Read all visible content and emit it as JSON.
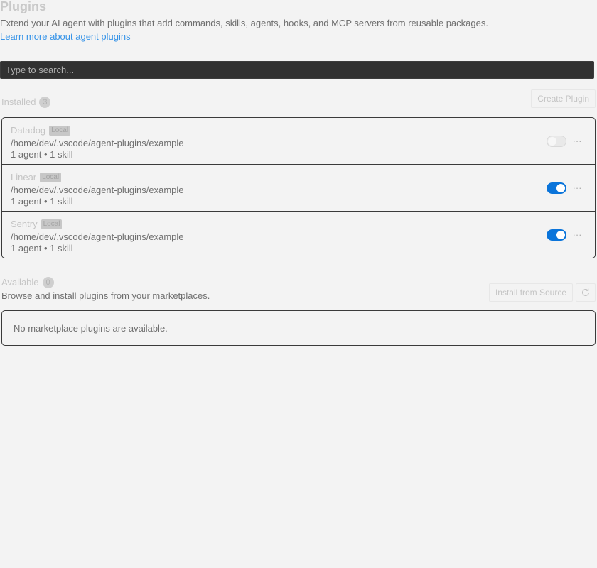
{
  "header": {
    "title": "Plugins",
    "description": "Extend your AI agent with plugins that add commands, skills, agents, hooks, and MCP servers from reusable packages.",
    "learn_more": "Learn more about agent plugins"
  },
  "search": {
    "placeholder": "Type to search...",
    "value": ""
  },
  "installed": {
    "label": "Installed",
    "count": "3",
    "create_button": "Create Plugin",
    "items": [
      {
        "name": "Datadog",
        "badge": "Local",
        "path": "/home/dev/.vscode/agent-plugins/example",
        "summary": "1 agent • 1 skill",
        "enabled": false
      },
      {
        "name": "Linear",
        "badge": "Local",
        "path": "/home/dev/.vscode/agent-plugins/example",
        "summary": "1 agent • 1 skill",
        "enabled": true
      },
      {
        "name": "Sentry",
        "badge": "Local",
        "path": "/home/dev/.vscode/agent-plugins/example",
        "summary": "1 agent • 1 skill",
        "enabled": true
      }
    ]
  },
  "available": {
    "label": "Available",
    "count": "0",
    "description": "Browse and install plugins from your marketplaces.",
    "install_button": "Install from Source",
    "refresh_icon": "refresh-icon",
    "empty_message": "No marketplace plugins are available."
  },
  "colors": {
    "accent": "#0a74da",
    "link": "#3794e8",
    "search_bg": "#313131"
  }
}
